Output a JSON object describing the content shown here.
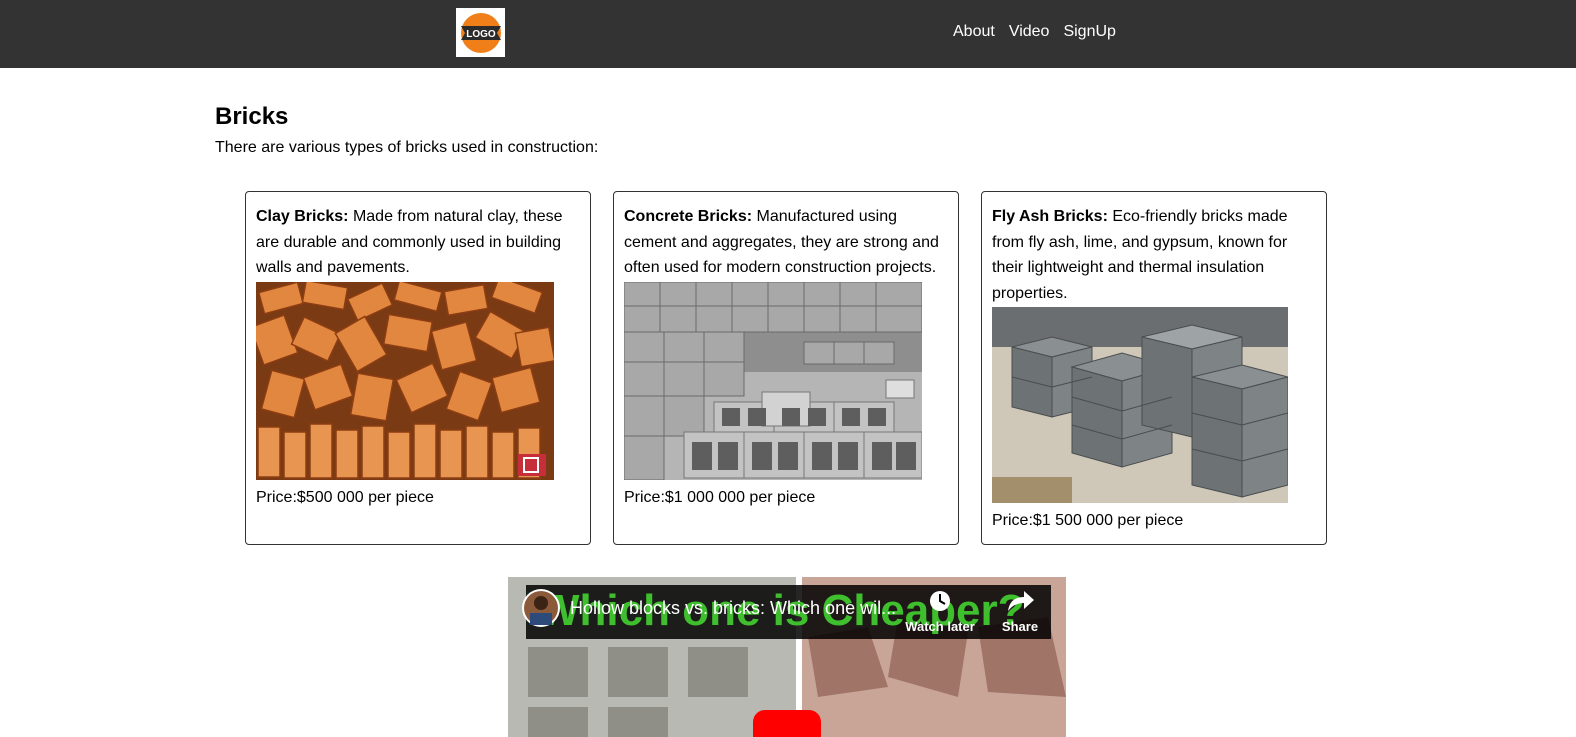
{
  "header": {
    "logo_text": "LOGO",
    "nav": [
      {
        "label": "About"
      },
      {
        "label": "Video"
      },
      {
        "label": "SignUp"
      }
    ]
  },
  "main": {
    "title": "Bricks",
    "intro": "There are various types of bricks used in construction:",
    "cards": [
      {
        "name": "Clay Bricks:",
        "description": " Made from natural clay, these are durable and commonly used in building walls and pavements.",
        "price": "Price:$500 000 per piece"
      },
      {
        "name": "Concrete Bricks:",
        "description": " Manufactured using cement and aggregates, they are strong and often used for modern construction projects.",
        "price": "Price:$1 000 000 per piece"
      },
      {
        "name": "Fly Ash Bricks:",
        "description": " Eco-friendly bricks made from fly ash, lime, and gypsum, known for their lightweight and thermal insulation properties.",
        "price": "Price:$1 500 000 per piece"
      }
    ]
  },
  "video": {
    "title": "Hollow blocks vs. bricks: Which one wil...",
    "thumbnail_text": "Which one is Cheaper?",
    "watch_later": "Watch later",
    "share": "Share"
  },
  "colors": {
    "navbar": "#333333",
    "logo_orange": "#f07f1a",
    "brick_orange": "#e2873f",
    "concrete_gray": "#9a9a9a",
    "flyash_gray": "#7d8285",
    "thumbnail_green": "#3fbf2e",
    "youtube_red": "#ff0000"
  },
  "icons": [
    "logo-icon",
    "channel-avatar-icon",
    "clock-icon",
    "share-icon",
    "play-icon"
  ]
}
